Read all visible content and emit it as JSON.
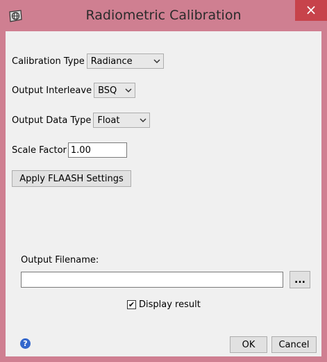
{
  "window": {
    "title": "Radiometric Calibration",
    "close_glyph": "×"
  },
  "form": {
    "calibration_type": {
      "label": "Calibration Type",
      "value": "Radiance"
    },
    "output_interleave": {
      "label": "Output Interleave",
      "value": "BSQ"
    },
    "output_data_type": {
      "label": "Output Data Type",
      "value": "Float"
    },
    "scale_factor": {
      "label": "Scale Factor",
      "value": "1.00"
    },
    "apply_flaash_label": "Apply FLAASH Settings",
    "output_filename": {
      "label": "Output Filename:",
      "value": "",
      "browse_label": "..."
    },
    "display_result": {
      "label": "Display result",
      "checked": true,
      "check_glyph": "✔"
    }
  },
  "footer": {
    "help_glyph": "?",
    "ok_label": "OK",
    "cancel_label": "Cancel"
  },
  "icons": {
    "app": "envi-globe-icon",
    "chevron": "chevron-down-icon",
    "help": "question-circle-icon",
    "close": "close-icon"
  },
  "colors": {
    "titlebar": "#cf7f91",
    "close_button": "#c7434b",
    "dialog_bg": "#f0f0f0",
    "help_blue": "#3367cc"
  }
}
